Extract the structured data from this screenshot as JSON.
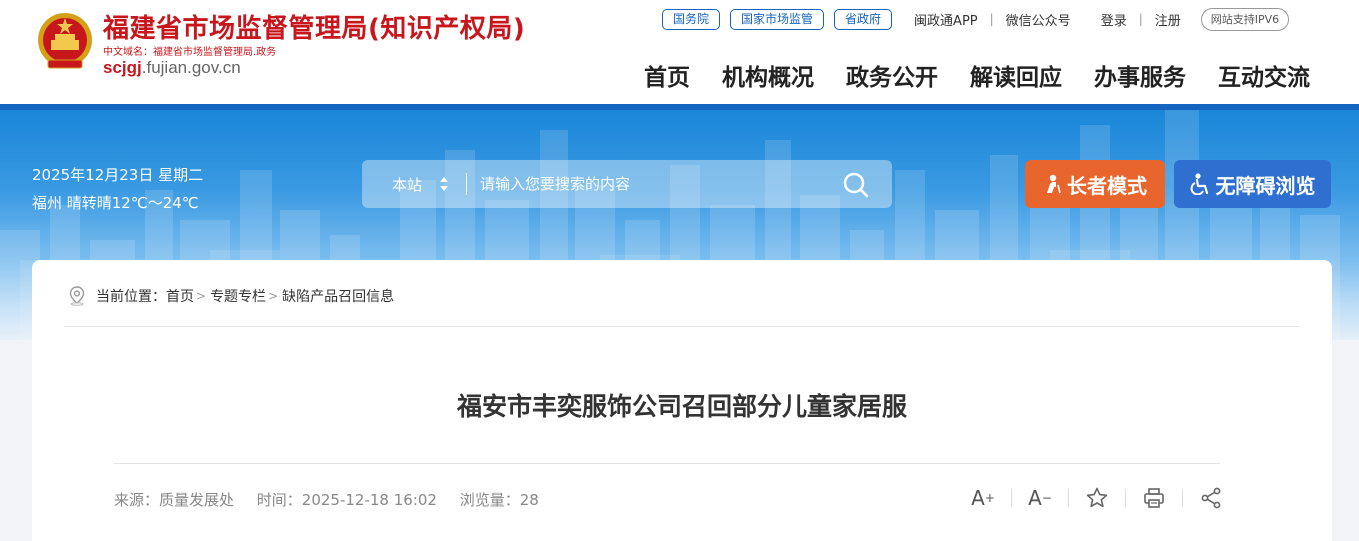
{
  "header": {
    "site_title": "福建省市场监督管理局(知识产权局)",
    "cn_domain": "中文域名：福建省市场监督管理局.政务",
    "domain_main": "scjgj",
    "domain_rest": ".fujian.gov.cn",
    "emblem_icon": "national-emblem-icon",
    "brand_color": "#c8161d"
  },
  "top_links": {
    "pills": [
      "国务院",
      "国家市场监管",
      "省政府"
    ],
    "app": "闽政通APP",
    "wechat": "微信公众号",
    "login": "登录",
    "register": "注册",
    "ipv6": "网站支持IPV6"
  },
  "nav": [
    "首页",
    "机构概况",
    "政务公开",
    "解读回应",
    "办事服务",
    "互动交流"
  ],
  "banner": {
    "date": "2025年12月23日  星期二",
    "weather": "福州  晴转晴12℃～24℃",
    "search_scope": "本站",
    "search_placeholder": "请输入您要搜索的内容",
    "elder_label": "长者模式",
    "access_label": "无障碍浏览",
    "elder_color": "#e8662e",
    "access_color": "#2f6fd0"
  },
  "breadcrumb": {
    "prefix": "当前位置：",
    "items": [
      "首页",
      "专题专栏",
      "缺陷产品召回信息"
    ]
  },
  "article": {
    "title": "福安市丰奕服饰公司召回部分儿童家居服",
    "source": "来源：质量发展处",
    "time": "时间：2025-12-18 16:02",
    "views": "浏览量：28"
  },
  "tools": [
    "font-increase-icon",
    "font-decrease-icon",
    "favorite-star-icon",
    "print-icon",
    "share-icon"
  ]
}
